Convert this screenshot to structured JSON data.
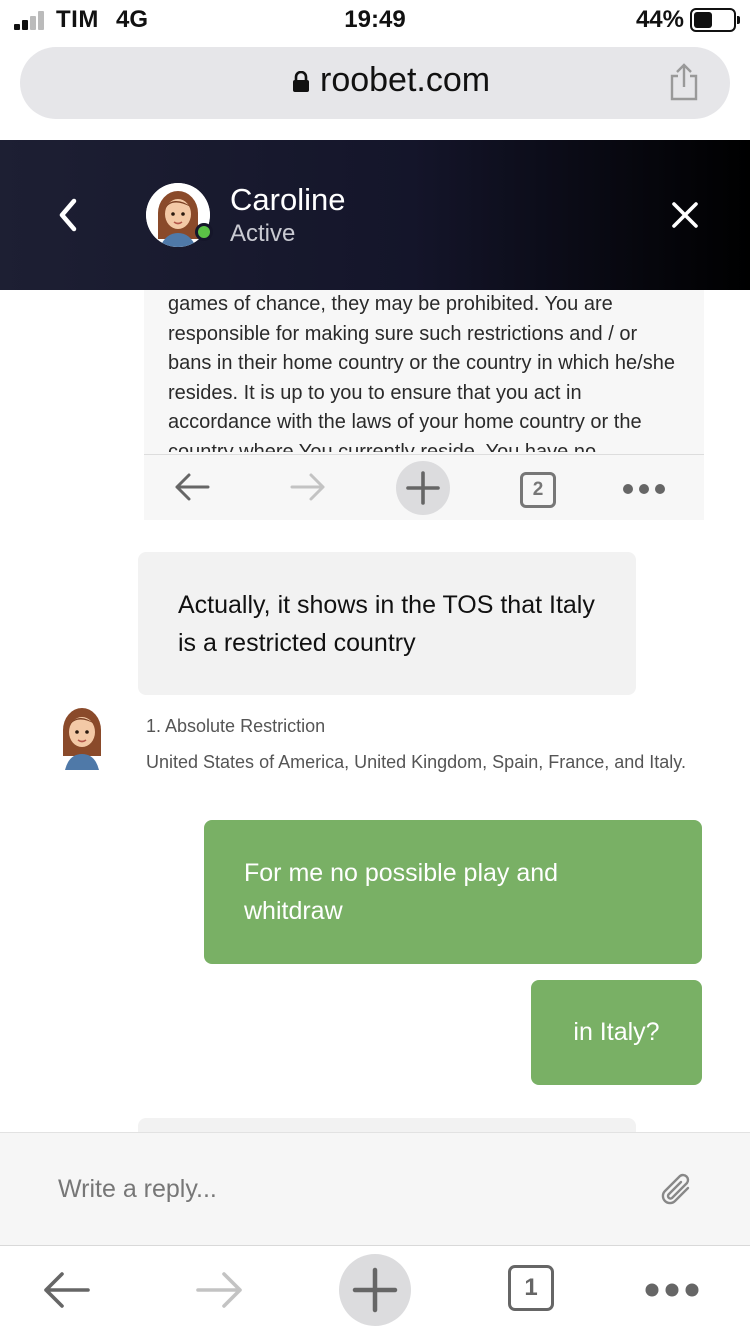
{
  "status_bar": {
    "carrier": "TIM",
    "network": "4G",
    "time": "19:49",
    "battery_percent": "44%"
  },
  "browser": {
    "url": "roobet.com",
    "icons": [
      "lock-icon",
      "share-icon"
    ]
  },
  "chat_header": {
    "agent_name": "Caroline",
    "agent_status": "Active",
    "status_color": "#5bc246",
    "icons": [
      "back-chevron-icon",
      "close-icon"
    ]
  },
  "screenshot_message": {
    "tos_text": "games of chance, they may be prohibited. You are responsible for making sure such restrictions and / or bans in their home country or the country in which he/she resides. It is up to you to ensure that you act in accordance with the laws of your home country or the country where You currently reside. You have no",
    "tab_count": "2",
    "icons": [
      "arrow-left-icon",
      "arrow-right-icon",
      "plus-icon",
      "tabs-icon",
      "more-icon"
    ]
  },
  "messages": [
    {
      "from": "agent",
      "text": "Actually, it shows in the TOS that Italy is a restricted country"
    },
    {
      "from": "agent",
      "type": "image",
      "title": "1. Absolute Restriction",
      "body": "United States of America, United Kingdom, Spain, France, and Italy."
    },
    {
      "from": "user",
      "text": "For me no possible play and whitdraw"
    },
    {
      "from": "user",
      "text": "in Italy?"
    }
  ],
  "composer": {
    "placeholder": "Write a reply...",
    "icons": [
      "paperclip-icon"
    ]
  },
  "browser_toolbar": {
    "tab_count": "1",
    "icons": [
      "back-arrow-icon",
      "forward-arrow-icon",
      "new-tab-plus-icon",
      "tabs-icon",
      "more-icon"
    ]
  },
  "colors": {
    "header_dark": "#1d1f33",
    "user_bubble": "#79b065",
    "agent_bubble": "#f2f2f2"
  }
}
